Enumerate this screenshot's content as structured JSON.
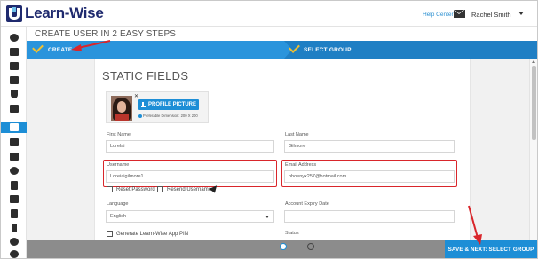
{
  "app": {
    "brand": "Learn-Wise"
  },
  "topbar": {
    "help_label": "Help Center",
    "user_name": "Rachel Smith"
  },
  "page": {
    "title": "CREATE USER IN 2 EASY STEPS"
  },
  "steps": [
    {
      "label": "CREATE",
      "state": "active"
    },
    {
      "label": "SELECT GROUP",
      "state": "inactive"
    }
  ],
  "form": {
    "section_title": "STATIC FIELDS",
    "profile_button": "PROFILE PICTURE",
    "dimension_note": "Preferable Dimension: 200 X 200",
    "first_name": {
      "label": "First Name",
      "value": "Lorelai"
    },
    "last_name": {
      "label": "Last Name",
      "value": "Gilmore"
    },
    "username": {
      "label": "Username",
      "value": "Loreiaigilmore1"
    },
    "email": {
      "label": "Email Address",
      "value": "phoenyx257@hotmail.com"
    },
    "reset_password": "Reset Password",
    "resend_username": "Resend Username",
    "language": {
      "label": "Language",
      "value": "English"
    },
    "account_expiry": {
      "label": "Account Expiry Date",
      "value": ""
    },
    "generate_pin": "Generate Learn-Wise App PIN",
    "status_label": "Status"
  },
  "footer": {
    "save_next_label": "SAVE & NEXT: SELECT GROUP"
  },
  "colors": {
    "primary": "#1d8ed6",
    "highlight": "#d9262b",
    "brand_dark": "#1f2a6e",
    "check": "#f3c02e"
  },
  "sidebar_icons": [
    "dashboard-icon",
    "courses-icon",
    "library-icon",
    "calendar-icon",
    "trophy-icon",
    "presentation-icon",
    "users-icon",
    "share-icon",
    "envelope-icon",
    "reports-icon",
    "documents-icon",
    "analytics-icon",
    "checklist-icon",
    "mobile-icon",
    "settings-icon",
    "pie-chart-icon"
  ]
}
